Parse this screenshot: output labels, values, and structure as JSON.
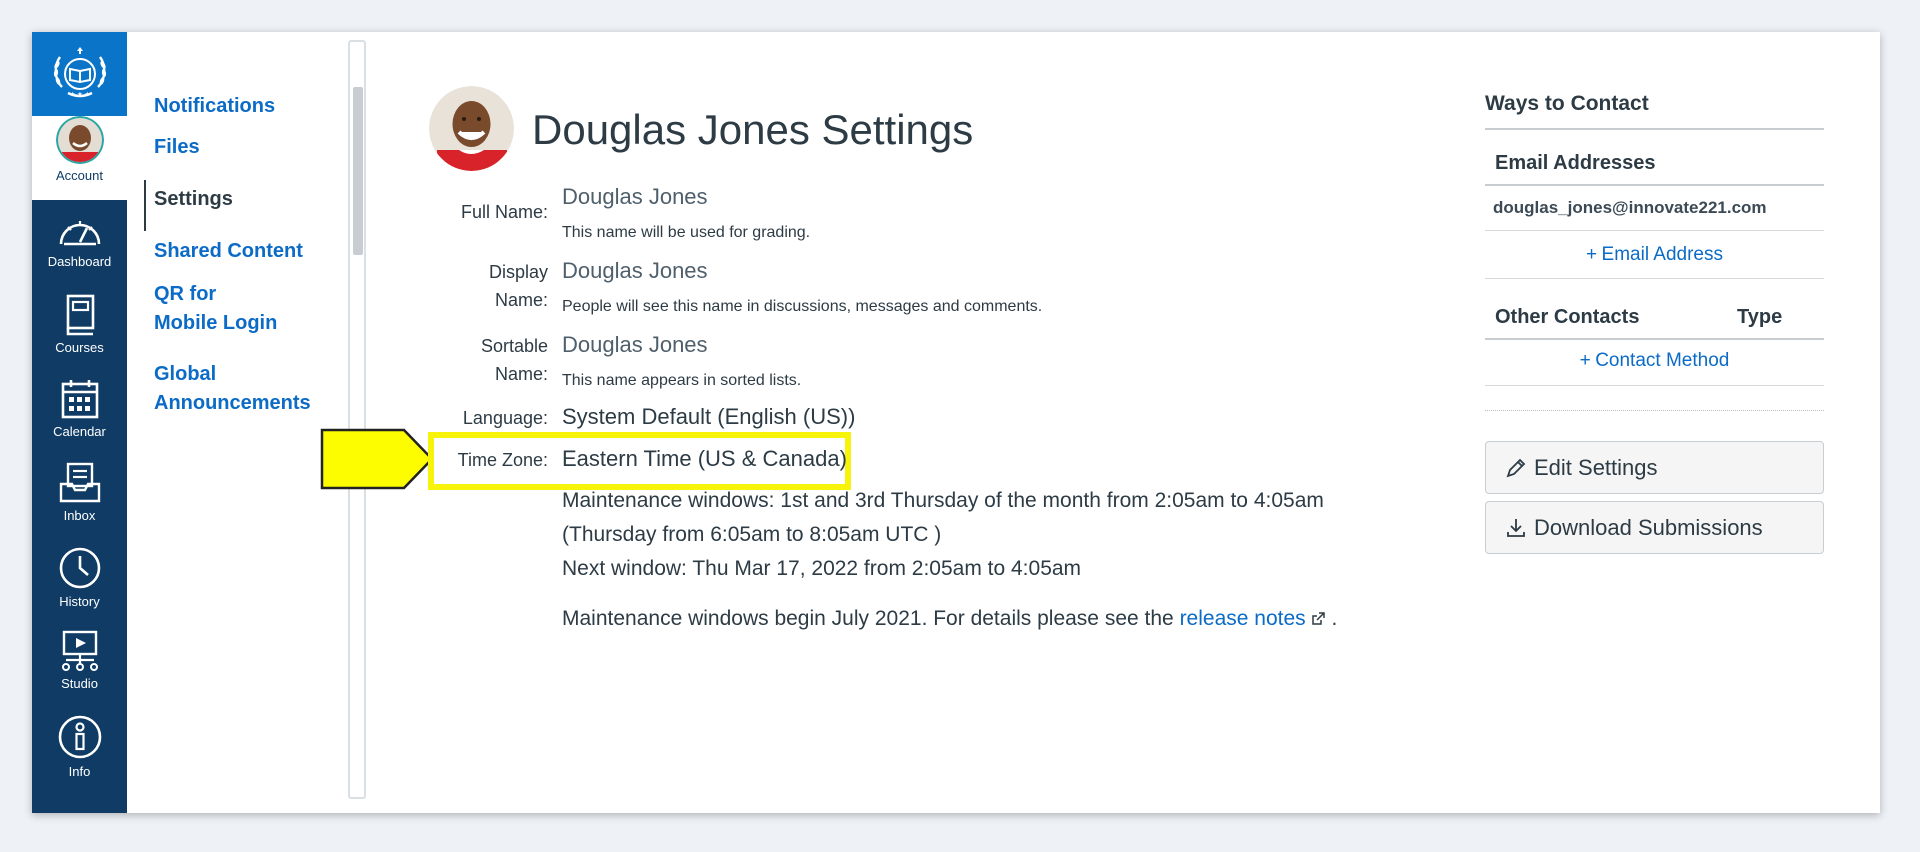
{
  "global_nav": {
    "items": [
      {
        "label": "Account",
        "icon": "avatar"
      },
      {
        "label": "Dashboard",
        "icon": "dashboard-icon"
      },
      {
        "label": "Courses",
        "icon": "courses-icon"
      },
      {
        "label": "Calendar",
        "icon": "calendar-icon"
      },
      {
        "label": "Inbox",
        "icon": "inbox-icon"
      },
      {
        "label": "History",
        "icon": "history-icon"
      },
      {
        "label": "Studio",
        "icon": "studio-icon"
      },
      {
        "label": "Info",
        "icon": "info-icon"
      }
    ]
  },
  "settings_nav": {
    "notifications": "Notifications",
    "files": "Files",
    "settings": "Settings",
    "shared_content": "Shared Content",
    "qr_line1": "QR for",
    "qr_line2": "Mobile Login",
    "global_line1": "Global",
    "global_line2": "Announcements"
  },
  "profile": {
    "title": "Douglas Jones Settings",
    "full_name_label": "Full Name:",
    "full_name": "Douglas Jones",
    "full_name_hint": "This name will be used for grading.",
    "display_name_label_1": "Display",
    "display_name_label_2": "Name:",
    "display_name": "Douglas Jones",
    "display_name_hint": "People will see this name in discussions, messages and comments.",
    "sortable_name_label_1": "Sortable",
    "sortable_name_label_2": "Name:",
    "sortable_name": "Douglas Jones",
    "sortable_name_hint": "This name appears in sorted lists.",
    "language_label": "Language:",
    "language": "System Default (English (US))",
    "time_zone_label": "Time Zone:",
    "time_zone": "Eastern Time (US & Canada)",
    "maintenance_line1": "Maintenance windows: 1st and 3rd Thursday of the month from 2:05am to 4:05am",
    "maintenance_line2": "(Thursday from 6:05am to 8:05am UTC )",
    "next_window": "Next window: Thu Mar 17, 2022 from 2:05am to 4:05am",
    "maintenance_begin": "Maintenance windows begin July 2021. For details please see the",
    "release_notes": "release notes",
    "period": "."
  },
  "contact": {
    "heading": "Ways to Contact",
    "email_heading": "Email Addresses",
    "email": "douglas_jones@innovate221.com",
    "add_email": "Email Address",
    "other_heading": "Other Contacts",
    "type_heading": "Type",
    "add_contact": "Contact Method",
    "edit_settings": "Edit Settings",
    "download_submissions": "Download Submissions"
  },
  "colors": {
    "nav_bg": "#0f3b64",
    "logo_bg": "#0a74c9",
    "link": "#0b6bc6",
    "highlight": "#f7f30a"
  }
}
